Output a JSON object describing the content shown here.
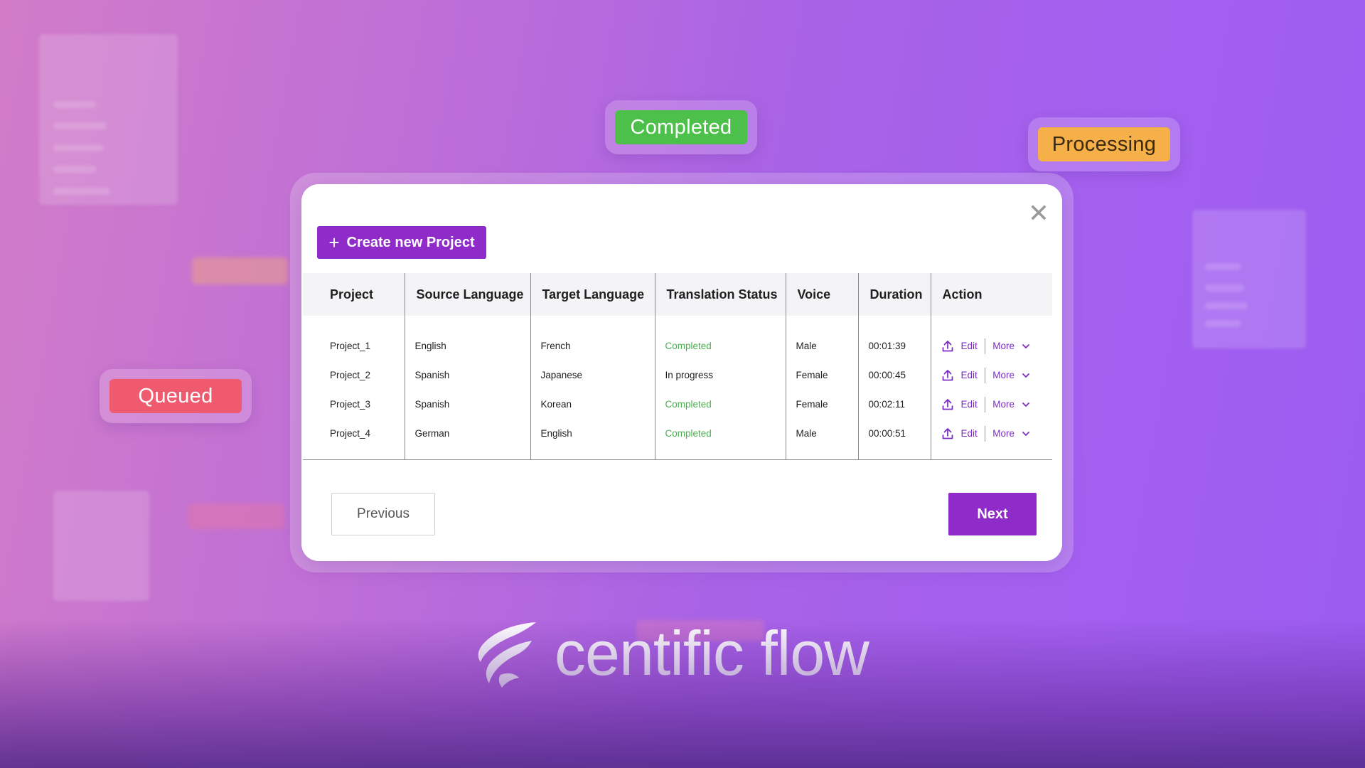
{
  "floating_chips": {
    "completed": "Completed",
    "processing": "Processing",
    "queued": "Queued"
  },
  "modal": {
    "create_button_label": "Create new Project",
    "close_icon": "close-icon",
    "table": {
      "headers": [
        "Project",
        "Source Language",
        "Target Language",
        "Translation Status",
        "Voice",
        "Duration",
        "Action"
      ],
      "rows": [
        {
          "project": "Project_1",
          "source": "English",
          "target": "French",
          "status": "Completed",
          "voice": "Male",
          "duration": "00:01:39"
        },
        {
          "project": "Project_2",
          "source": "Spanish",
          "target": "Japanese",
          "status": "In progress",
          "voice": "Female",
          "duration": "00:00:45"
        },
        {
          "project": "Project_3",
          "source": "Spanish",
          "target": "Korean",
          "status": "Completed",
          "voice": "Female",
          "duration": "00:02:11"
        },
        {
          "project": "Project_4",
          "source": "German",
          "target": "English",
          "status": "Completed",
          "voice": "Male",
          "duration": "00:00:51"
        }
      ],
      "action_edit_label": "Edit",
      "action_more_label": "More"
    },
    "previous_label": "Previous",
    "next_label": "Next"
  },
  "brand": {
    "name": "centific flow"
  },
  "colors": {
    "accent": "#8e2bc9",
    "completed_green": "#4caf50",
    "processing_orange": "#f5b04a",
    "queued_red": "#ef5a6f"
  }
}
